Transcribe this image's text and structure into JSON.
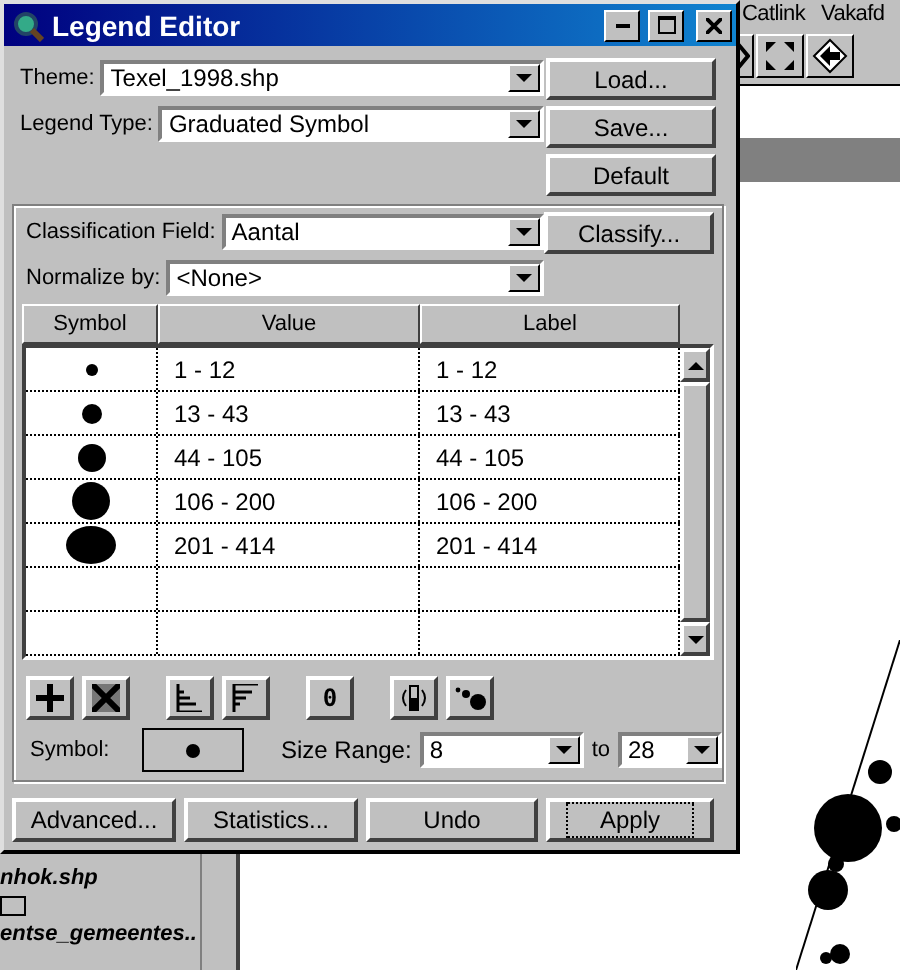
{
  "window": {
    "title": "Legend Editor"
  },
  "theme": {
    "label": "Theme:",
    "value": "Texel_1998.shp"
  },
  "legend_type": {
    "label": "Legend Type:",
    "value": "Graduated Symbol"
  },
  "side_buttons": [
    "Load...",
    "Save...",
    "Default"
  ],
  "classification_field": {
    "label": "Classification Field:",
    "value": "Aantal"
  },
  "classify_button": "Classify...",
  "normalize_by": {
    "label": "Normalize by:",
    "value": "<None>"
  },
  "table": {
    "columns": [
      "Symbol",
      "Value",
      "Label"
    ],
    "rows": [
      {
        "value": "1 - 12",
        "label": "1 - 12"
      },
      {
        "value": "13 - 43",
        "label": "13 - 43"
      },
      {
        "value": "44 - 105",
        "label": "44 - 105"
      },
      {
        "value": "106 - 200",
        "label": "106 - 200"
      },
      {
        "value": "201 - 414",
        "label": "201 - 414"
      }
    ]
  },
  "toolbar": [
    {
      "kind": "add"
    },
    {
      "kind": "delete"
    },
    {
      "kind": "sort-asc"
    },
    {
      "kind": "sort-desc"
    },
    {
      "kind": "text",
      "text": "0"
    },
    {
      "kind": "flip"
    },
    {
      "kind": "dots"
    }
  ],
  "symbol": {
    "label": "Symbol:"
  },
  "size_range": {
    "label": "Size Range:",
    "from": "8",
    "to_label": "to",
    "to": "28"
  },
  "bottom_buttons": [
    {
      "label": "Advanced...",
      "focused": false
    },
    {
      "label": "Statistics...",
      "focused": false
    },
    {
      "label": "Undo",
      "focused": false
    },
    {
      "label": "Apply",
      "focused": true
    }
  ],
  "background": {
    "menu": [
      "Catlink",
      "Vakafd"
    ],
    "toc": [
      "nhok.shp",
      "entse_gemeentes.."
    ]
  }
}
